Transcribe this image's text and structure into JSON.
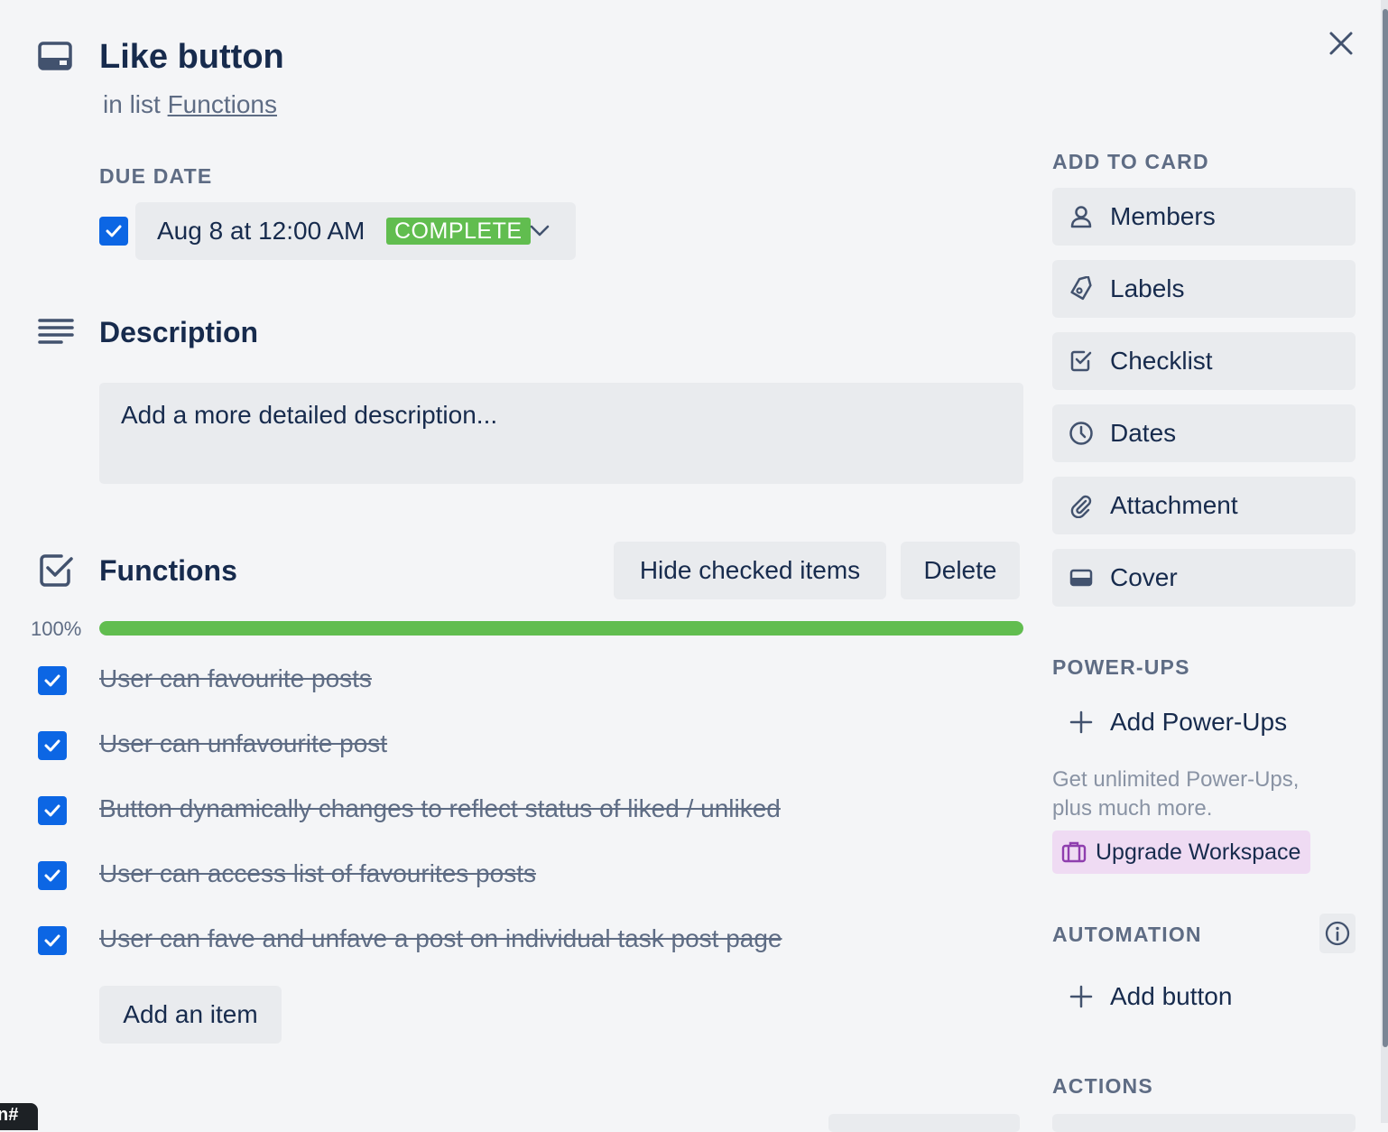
{
  "card": {
    "title": "Like button",
    "list_prefix": "in list",
    "list_name": "Functions"
  },
  "due_date": {
    "section_label": "DUE DATE",
    "value": "Aug 8 at 12:00 AM",
    "status": "COMPLETE",
    "checked": true
  },
  "description": {
    "heading": "Description",
    "placeholder": "Add a more detailed description..."
  },
  "checklist": {
    "title": "Functions",
    "hide_checked_label": "Hide checked items",
    "delete_label": "Delete",
    "progress_percent": 100,
    "progress_label": "100%",
    "items": [
      {
        "text": "User can favourite posts",
        "checked": true
      },
      {
        "text": "User can unfavourite post",
        "checked": true
      },
      {
        "text": "Button dynamically changes to reflect status of liked / unliked",
        "checked": true
      },
      {
        "text": "User can access list of favourites posts",
        "checked": true
      },
      {
        "text": "User can fave and unfave a post on individual task post page",
        "checked": true
      }
    ],
    "add_item_label": "Add an item"
  },
  "sidebar": {
    "add_to_card_label": "ADD TO CARD",
    "add_to_card": [
      {
        "label": "Members",
        "icon": "person-icon"
      },
      {
        "label": "Labels",
        "icon": "tag-icon"
      },
      {
        "label": "Checklist",
        "icon": "checklist-icon"
      },
      {
        "label": "Dates",
        "icon": "clock-icon"
      },
      {
        "label": "Attachment",
        "icon": "paperclip-icon"
      },
      {
        "label": "Cover",
        "icon": "cover-icon"
      }
    ],
    "power_ups_label": "POWER-UPS",
    "add_power_ups_label": "Add Power-Ups",
    "power_ups_promo_line1": "Get unlimited Power-Ups,",
    "power_ups_promo_line2": "plus much more.",
    "upgrade_label": "Upgrade Workspace",
    "automation_label": "AUTOMATION",
    "add_button_label": "Add button",
    "actions_label": "ACTIONS"
  },
  "footer_fragment": "n#",
  "colors": {
    "background": "#f4f5f7",
    "complete_badge": "#61bd4f",
    "progress_fill": "#61bd4f",
    "checkbox": "#0c66e4",
    "upgrade_bg": "#efdbf3",
    "upgrade_icon": "#8f3fae"
  }
}
